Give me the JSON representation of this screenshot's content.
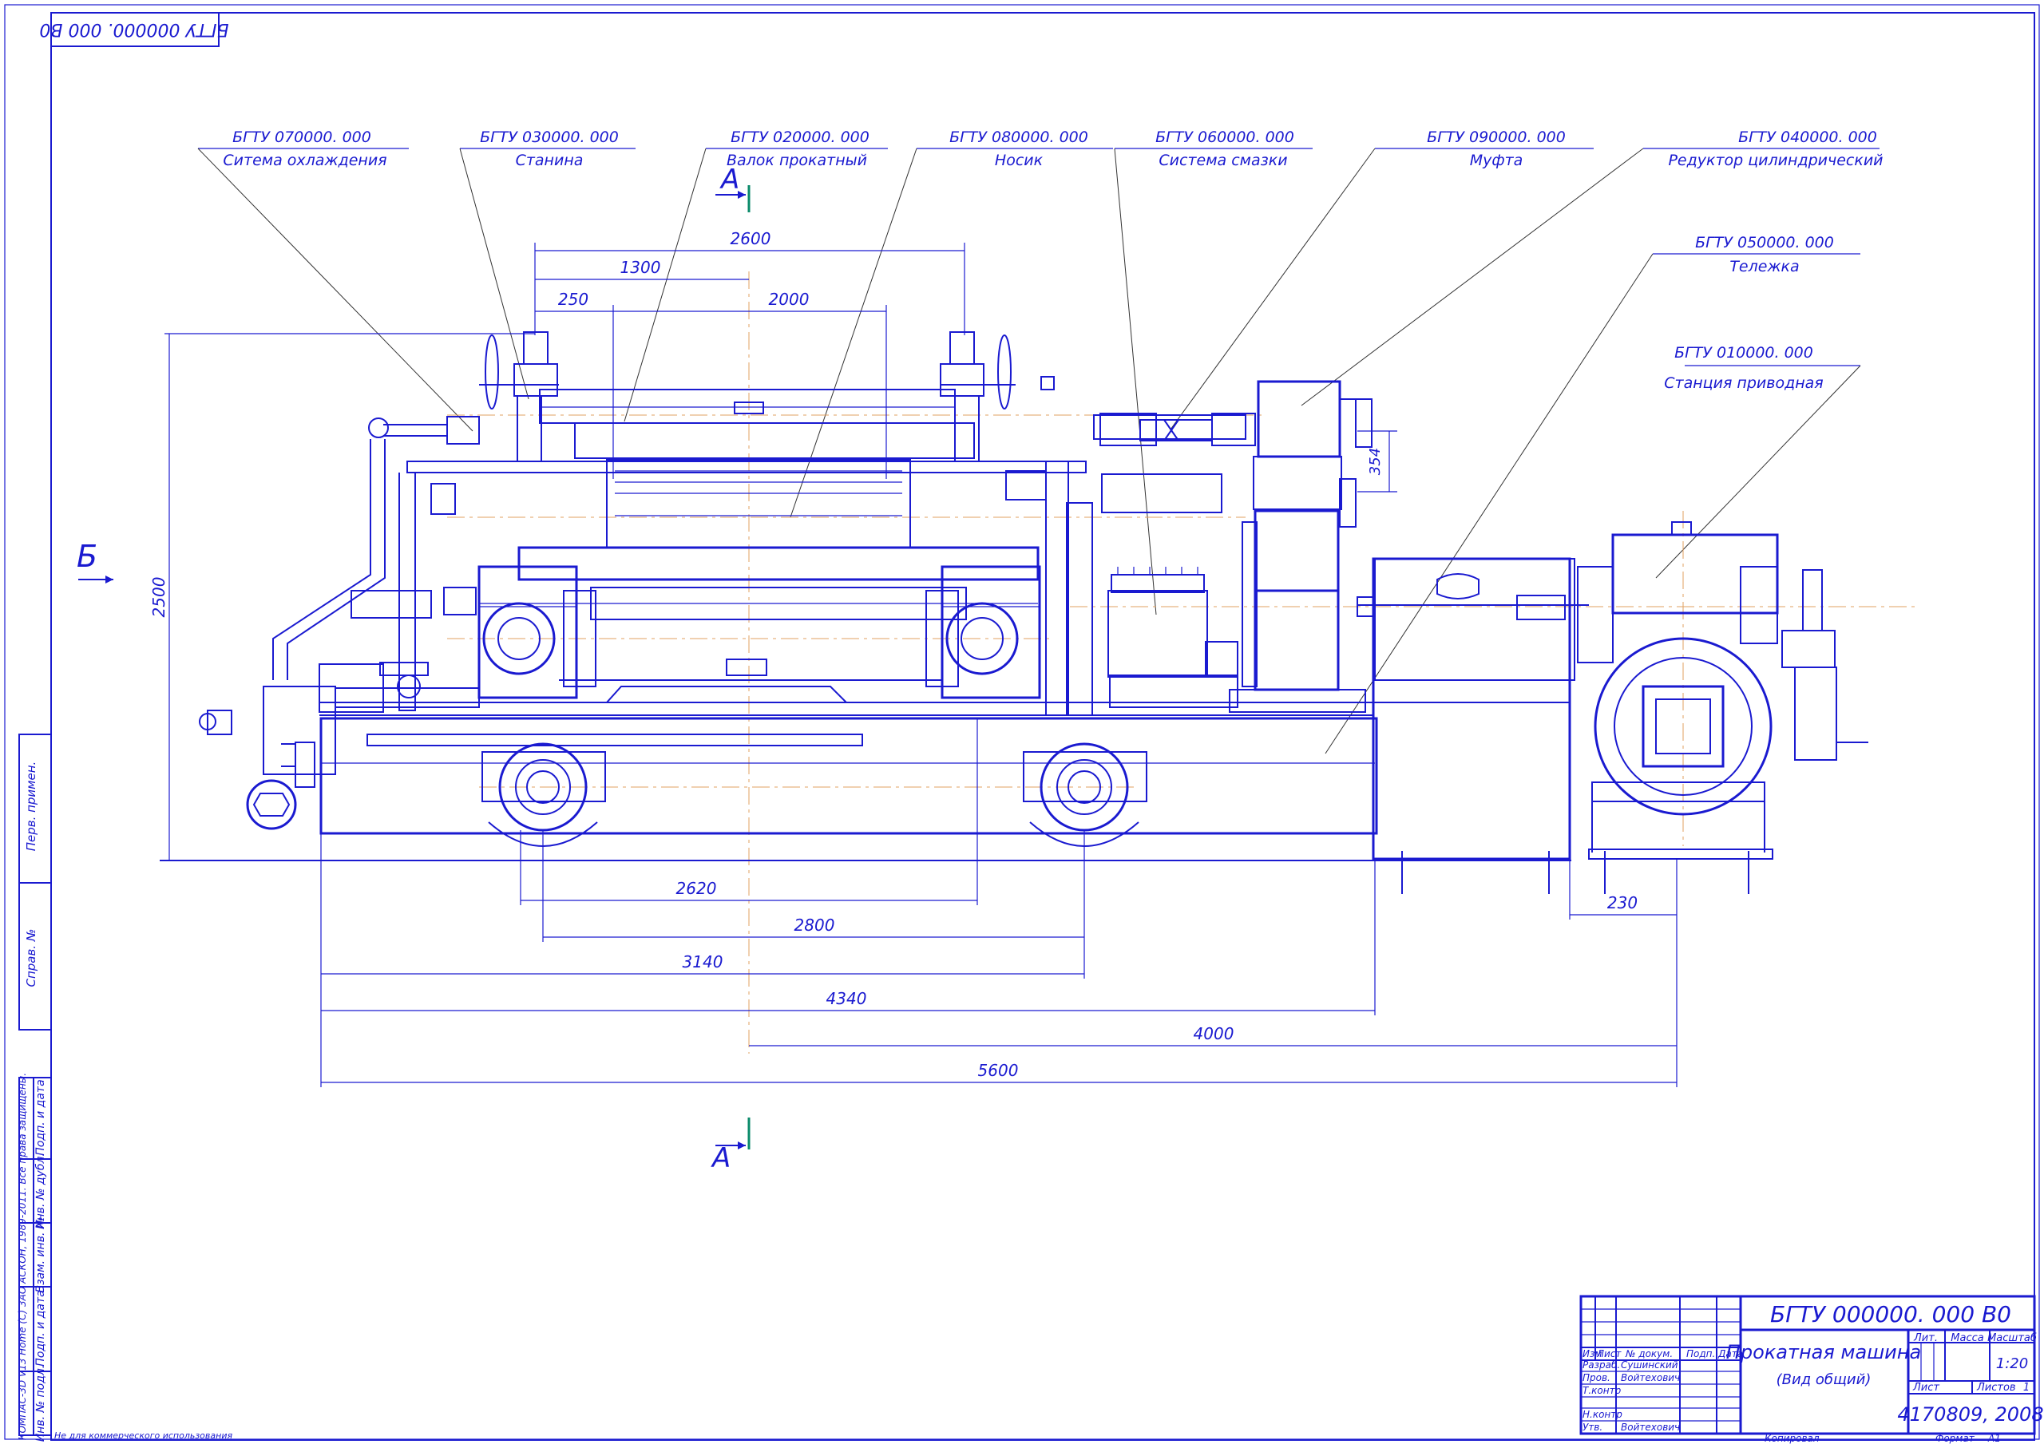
{
  "stamp_mirrored": "БГТУ 000000. 000 В0",
  "callouts": [
    {
      "code": "БГТУ 070000. 000",
      "name": "Ситема охлаждения"
    },
    {
      "code": "БГТУ 030000. 000",
      "name": "Станина"
    },
    {
      "code": "БГТУ 020000. 000",
      "name": "Валок прокатный"
    },
    {
      "code": "БГТУ 080000. 000",
      "name": "Носик"
    },
    {
      "code": "БГТУ 060000. 000",
      "name": "Система смазки"
    },
    {
      "code": "БГТУ 090000. 000",
      "name": "Муфта"
    },
    {
      "code": "БГТУ 040000. 000",
      "name": "Редуктор цилиндрический"
    },
    {
      "code": "БГТУ 050000. 000",
      "name": "Тележка"
    },
    {
      "code": "БГТУ 010000. 000",
      "name": "Станция приводная"
    }
  ],
  "section_marks": {
    "a_top": "А",
    "a_bottom": "А",
    "b": "Б"
  },
  "dimensions": {
    "d2600": "2600",
    "d1300": "1300",
    "d250": "250",
    "d2000": "2000",
    "d2500": "2500",
    "d354": "354",
    "d2620": "2620",
    "d2800": "2800",
    "d3140": "3140",
    "d4340": "4340",
    "d4000": "4000",
    "d5600": "5600",
    "d230": "230"
  },
  "left_strip": {
    "perv_primen": "Перв. примен.",
    "sprav_no": "Справ. №",
    "podp_data_1": "Подп. и дата",
    "inv_dubl": "Инв. № дубл.",
    "vzam_inv": "Взам. инв. №",
    "podp_data_2": "Подп. и дата",
    "inv_podl": "Инв. № подл.",
    "kompas_note": "КОМПАС-3D V13 Home (C) 3АО АСКОН, 1989-2011. Все права защищены."
  },
  "footer_note": "Не для коммерческого использования",
  "title_block": {
    "designation": "БГТУ 000000. 000 В0",
    "name_line1": "Прокатная машина",
    "name_line2": "(Вид общий)",
    "h_izm": "Изм",
    "h_list": "Лист",
    "h_ndokum": "№ докум.",
    "h_podp": "Подп.",
    "h_data": "Дата",
    "r_razrab": "Разраб.",
    "v_razrab": "Сушинский",
    "r_prov": "Пров.",
    "v_prov": "Войтехович",
    "r_tkontr": "Т.контр",
    "r_nkontr": "Н.контр",
    "r_utv": "Утв.",
    "v_utv": "Войтехович",
    "lit": "Лит.",
    "massa": "Масса",
    "masshtab": "Масштаб",
    "scale": "1:20",
    "list": "Лист",
    "listov": "Листов",
    "listov_val": "1",
    "org": "4170809, 2008",
    "kopiroval": "Копировал",
    "format": "Формат",
    "format_val": "А1"
  },
  "colors": {
    "ink": "#1a1ad0",
    "axis": "#e0a060",
    "leader": "#333333"
  }
}
